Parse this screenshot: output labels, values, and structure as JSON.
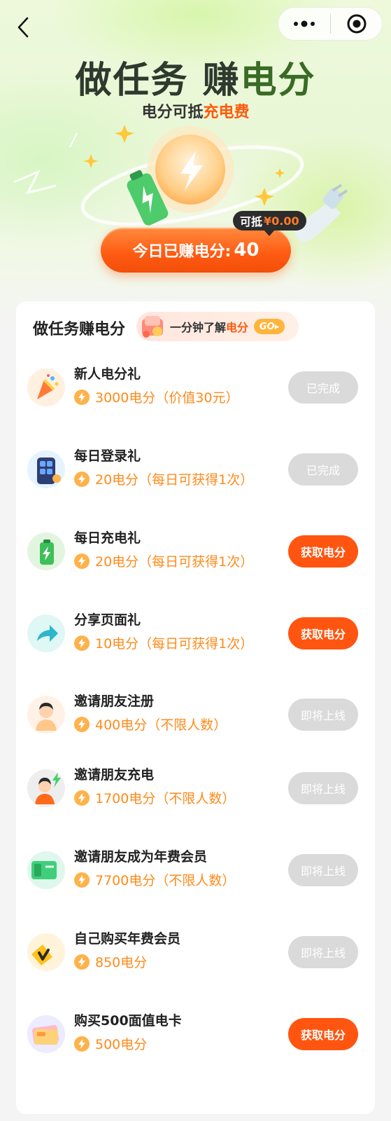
{
  "hero": {
    "title_main": "做任务 赚",
    "title_accent": "电分",
    "subtitle_prefix": "电分可抵",
    "subtitle_highlight": "充电费",
    "earned_label": "今日已赚电分:",
    "earned_value": "40",
    "worth_prefix": "可抵",
    "worth_amount": "¥0.00"
  },
  "card": {
    "title": "做任务赚电分",
    "learn_prefix": "一分钟了解",
    "learn_highlight": "电分",
    "learn_go": "GO"
  },
  "tasks": [
    {
      "name": "新人电分礼",
      "reward": "3000电分（价值30元）",
      "button": "已完成",
      "state": "done",
      "icon": "party-popper-icon"
    },
    {
      "name": "每日登录礼",
      "reward": "20电分（每日可获得1次）",
      "button": "已完成",
      "state": "done",
      "icon": "phone-login-icon"
    },
    {
      "name": "每日充电礼",
      "reward": "20电分（每日可获得1次）",
      "button": "获取电分",
      "state": "active",
      "icon": "battery-icon"
    },
    {
      "name": "分享页面礼",
      "reward": "10电分（每日可获得1次）",
      "button": "获取电分",
      "state": "active",
      "icon": "share-arrow-icon"
    },
    {
      "name": "邀请朋友注册",
      "reward": "400电分（不限人数）",
      "button": "即将上线",
      "state": "disabled",
      "icon": "person-avatar-icon"
    },
    {
      "name": "邀请朋友充电",
      "reward": "1700电分（不限人数）",
      "button": "即将上线",
      "state": "disabled",
      "icon": "person-charging-icon"
    },
    {
      "name": "邀请朋友成为年费会员",
      "reward": "7700电分（不限人数）",
      "button": "即将上线",
      "state": "disabled",
      "icon": "membership-card-icon"
    },
    {
      "name": "自己购买年费会员",
      "reward": "850电分",
      "button": "即将上线",
      "state": "disabled",
      "icon": "vip-badge-icon"
    },
    {
      "name": "购买500面值电卡",
      "reward": "500电分",
      "button": "获取电分",
      "state": "active",
      "icon": "gift-card-icon"
    }
  ],
  "colors": {
    "accent": "#ff5510",
    "reward_text": "#ff8a1a",
    "done_button": "#dadada"
  }
}
